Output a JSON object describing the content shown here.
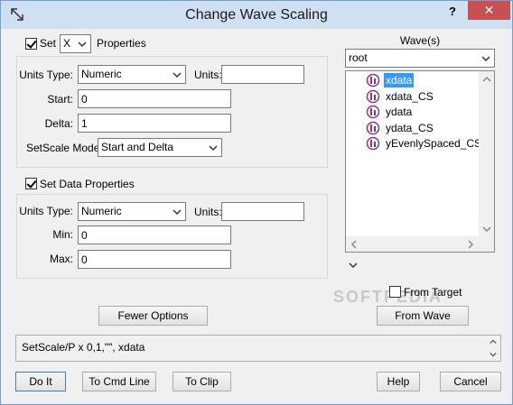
{
  "window": {
    "title": "Change Wave Scaling",
    "help_label": "?",
    "close_label": "✕"
  },
  "x_section": {
    "set_label": "Set",
    "set_checked": true,
    "axis_value": "X",
    "properties_label": "Properties",
    "units_type_label": "Units Type:",
    "units_type_value": "Numeric",
    "units_label": "Units:",
    "units_value": "",
    "start_label": "Start:",
    "start_value": "0",
    "delta_label": "Delta:",
    "delta_value": "1",
    "setscale_mode_label": "SetScale Mode:",
    "setscale_mode_value": "Start and Delta"
  },
  "data_section": {
    "set_data_label": "Set Data Properties",
    "set_data_checked": true,
    "units_type_label": "Units Type:",
    "units_type_value": "Numeric",
    "units_label": "Units:",
    "units_value": "",
    "min_label": "Min:",
    "min_value": "0",
    "max_label": "Max:",
    "max_value": "0"
  },
  "waves": {
    "label": "Wave(s)",
    "folder_value": "root",
    "items": [
      "xdata",
      "xdata_CS",
      "ydata",
      "ydata_CS",
      "yEvenlySpaced_CS"
    ],
    "selected_index": 0,
    "from_target_label": "From Target",
    "from_target_checked": false,
    "from_wave_label": "From Wave"
  },
  "fewer_options_label": "Fewer Options",
  "command_text": "SetScale/P x 0,1,\"\", xdata",
  "buttons": {
    "do_it": "Do It",
    "to_cmd_line": "To Cmd Line",
    "to_clip": "To Clip",
    "help": "Help",
    "cancel": "Cancel"
  },
  "watermark_text": "SOFTPEDIA"
}
